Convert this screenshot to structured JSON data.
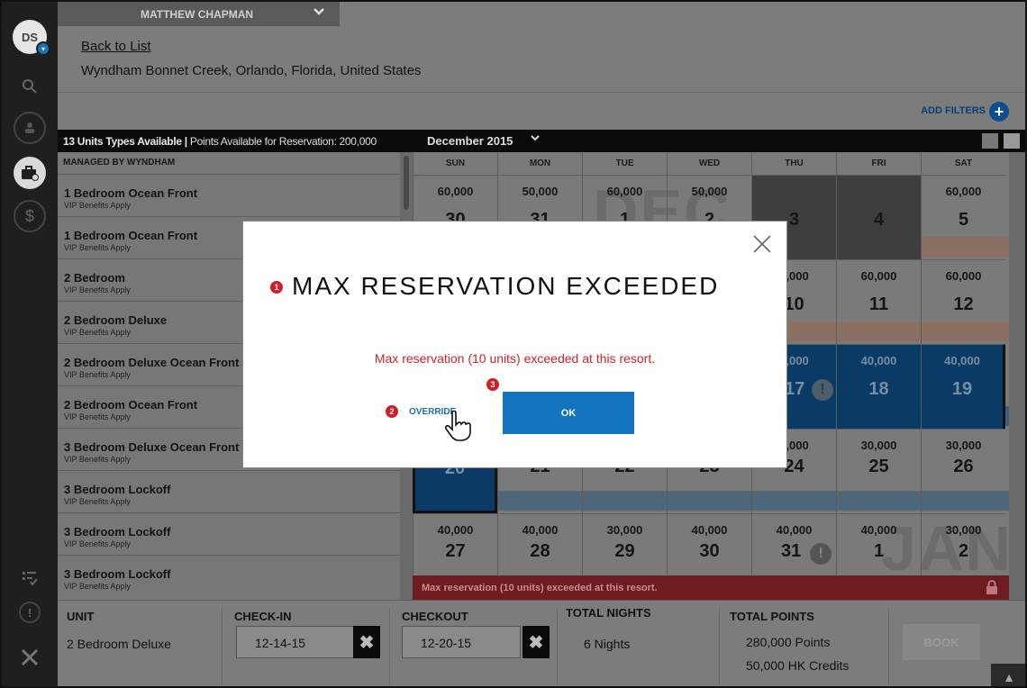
{
  "sidebar": {
    "avatar_initials": "DS",
    "icons": [
      "search-icon",
      "user-icon",
      "briefcase-add-icon",
      "dollar-icon",
      "checklist-icon",
      "alert-icon",
      "tools-icon"
    ]
  },
  "header": {
    "user_name": "MATTHEW CHAPMAN",
    "back_link": "Back to List",
    "resort": "Wyndham Bonnet Creek, Orlando, Florida, United States",
    "add_filters": "ADD FILTERS"
  },
  "bar": {
    "units_bold": "13 Units Types Available |",
    "units_points": " Points Available for Reservation: 200,000",
    "month": "December 2015"
  },
  "units": {
    "heading": "MANAGED BY WYNDHAM",
    "items": [
      {
        "name": "1 Bedroom Ocean Front",
        "sub": "VIP Benefits Apply"
      },
      {
        "name": "1 Bedroom Ocean Front",
        "sub": "VIP Benefits Apply"
      },
      {
        "name": "2 Bedroom",
        "sub": "VIP Benefits Apply"
      },
      {
        "name": "2 Bedroom Deluxe",
        "sub": "VIP Benefits Apply"
      },
      {
        "name": "2 Bedroom Deluxe Ocean Front",
        "sub": "VIP Benefits Apply"
      },
      {
        "name": "2 Bedroom Ocean Front",
        "sub": "VIP Benefits Apply"
      },
      {
        "name": "3 Bedroom Deluxe Ocean Front",
        "sub": "VIP Benefits Apply"
      },
      {
        "name": "3 Bedroom Lockoff",
        "sub": "VIP Benefits Apply"
      },
      {
        "name": "3 Bedroom Lockoff",
        "sub": "VIP Benefits Apply"
      },
      {
        "name": "3 Bedroom Lockoff",
        "sub": "VIP Benefits Apply"
      }
    ]
  },
  "calendar": {
    "days_of_week": [
      "SUN",
      "MON",
      "TUE",
      "WED",
      "THU",
      "FRI",
      "SAT"
    ],
    "month_watermark_dec": "DEC",
    "month_watermark_jan": "JAN",
    "weeks": [
      [
        {
          "pts": "60,000",
          "day": "30"
        },
        {
          "pts": "50,000",
          "day": "31"
        },
        {
          "pts": "60,000",
          "day": "1"
        },
        {
          "pts": "50,000",
          "day": "2"
        },
        {
          "pts": "",
          "day": "3"
        },
        {
          "pts": "",
          "day": "4"
        },
        {
          "pts": "60,000",
          "day": "5"
        }
      ],
      [
        {
          "pts": "",
          "day": ""
        },
        {
          "pts": "",
          "day": ""
        },
        {
          "pts": "",
          "day": ""
        },
        {
          "pts": "",
          "day": ""
        },
        {
          "pts": "0,000",
          "day": "10"
        },
        {
          "pts": "60,000",
          "day": "11"
        },
        {
          "pts": "60,000",
          "day": "12"
        }
      ],
      [
        {
          "pts": "",
          "day": ""
        },
        {
          "pts": "",
          "day": ""
        },
        {
          "pts": "",
          "day": ""
        },
        {
          "pts": "",
          "day": ""
        },
        {
          "pts": "0,000",
          "day": "17"
        },
        {
          "pts": "40,000",
          "day": "18"
        },
        {
          "pts": "40,000",
          "day": "19"
        }
      ],
      [
        {
          "pts": "",
          "day": "20"
        },
        {
          "pts": "",
          "day": "21"
        },
        {
          "pts": "",
          "day": "22"
        },
        {
          "pts": "",
          "day": "23"
        },
        {
          "pts": "0,000",
          "day": "24"
        },
        {
          "pts": "30,000",
          "day": "25"
        },
        {
          "pts": "30,000",
          "day": "26"
        }
      ],
      [
        {
          "pts": "40,000",
          "day": "27"
        },
        {
          "pts": "40,000",
          "day": "28"
        },
        {
          "pts": "30,000",
          "day": "29"
        },
        {
          "pts": "40,000",
          "day": "30"
        },
        {
          "pts": "40,000",
          "day": "31"
        },
        {
          "pts": "40,000",
          "day": "1"
        },
        {
          "pts": "30,000",
          "day": "2"
        }
      ]
    ],
    "error_text": "Max reservation (10 units) exceeded at this resort."
  },
  "footer": {
    "unit_label": "UNIT",
    "unit_value": "2 Bedroom Deluxe",
    "checkin_label": "CHECK-IN",
    "checkin_value": "12-14-15",
    "checkout_label": "CHECKOUT",
    "checkout_value": "12-20-15",
    "nights_label": "TOTAL NIGHTS",
    "nights_value": "6 Nights",
    "points_label": "TOTAL POINTS",
    "points_value": "280,000 Points",
    "credits_value": "50,000 HK Credits",
    "book_label": "BOOK",
    "clear_glyph": "✖",
    "up_glyph": "▲"
  },
  "modal": {
    "title": "MAX RESERVATION EXCEEDED",
    "message": "Max reservation (10 units) exceeded at this resort.",
    "override_label": "OVERRIDE",
    "ok_label": "OK",
    "badge_1": "1",
    "badge_2": "2",
    "badge_3": "3"
  },
  "colors": {
    "accent_blue": "#1273be",
    "error_red": "#d21f2a",
    "badge_red": "#cf1f2a"
  }
}
